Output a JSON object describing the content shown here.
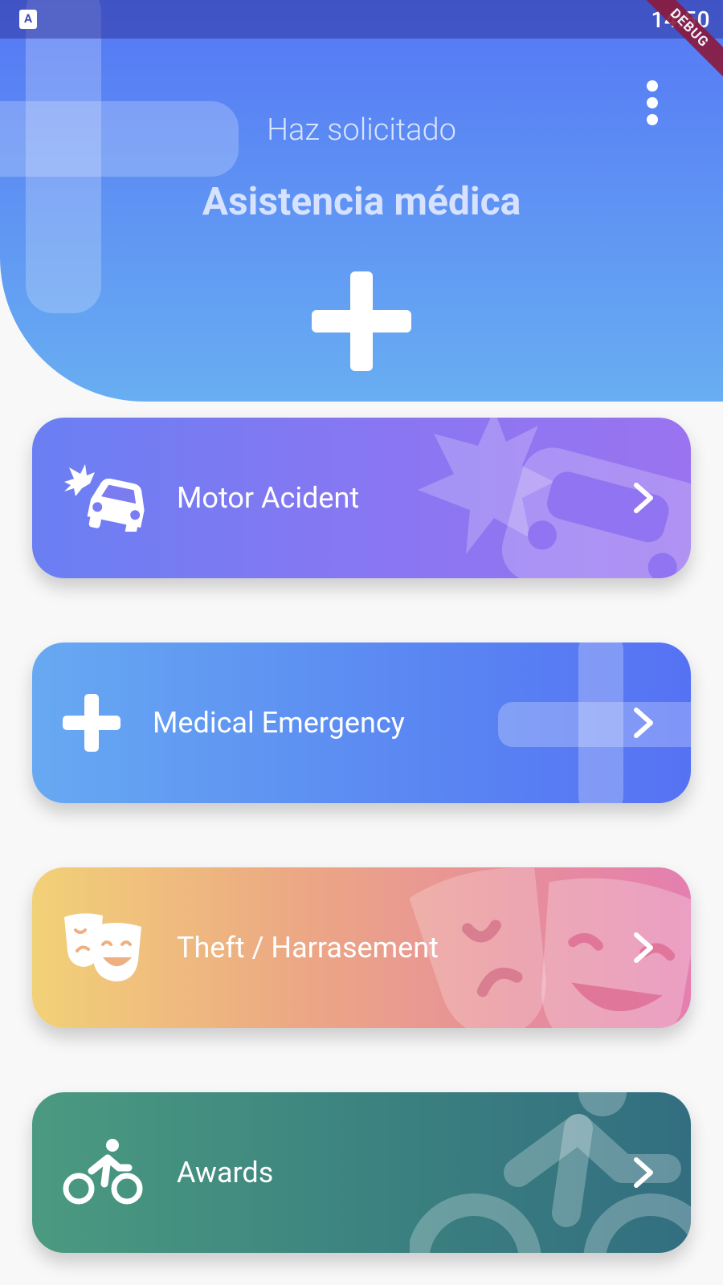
{
  "status_bar": {
    "time": "14:50",
    "debug_label": "DEBUG",
    "app_icon_letter": "A"
  },
  "header": {
    "subtitle": "Haz solicitado",
    "title": "Asistencia médica",
    "icon": "plus-icon",
    "menu_icon": "more-vert-icon"
  },
  "cards": [
    {
      "label": "Motor Acident",
      "icon": "car-crash-icon",
      "colors": [
        "#6a7ff3",
        "#9a74f0"
      ]
    },
    {
      "label": "Medical Emergency",
      "icon": "plus-icon",
      "colors": [
        "#67a9f2",
        "#5672f4"
      ]
    },
    {
      "label": "Theft / Harrasement",
      "icon": "theater-masks-icon",
      "colors": [
        "#f2d177",
        "#e47fb0"
      ]
    },
    {
      "label": "Awards",
      "icon": "biking-icon",
      "colors": [
        "#4b9a80",
        "#326e80"
      ]
    }
  ],
  "card_action_icon": "chevron-right-icon"
}
